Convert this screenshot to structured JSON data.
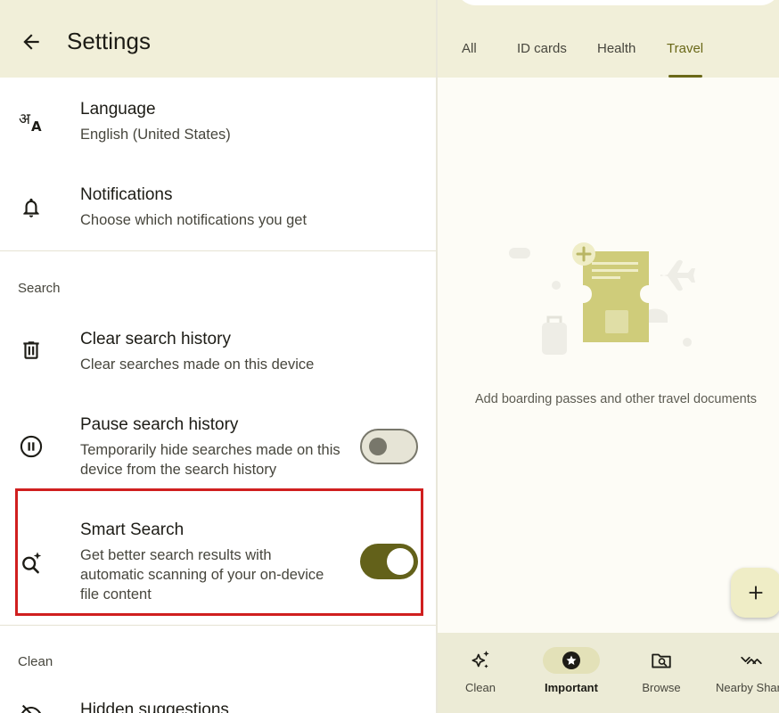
{
  "settings": {
    "title": "Settings",
    "general_items": [
      {
        "title": "Language",
        "subtitle": "English (United States)",
        "icon": "translate-icon"
      },
      {
        "title": "Notifications",
        "subtitle": "Choose which notifications you get",
        "icon": "bell-icon"
      }
    ],
    "search_section": {
      "label": "Search",
      "items": [
        {
          "title": "Clear search history",
          "subtitle": "Clear searches made on this device",
          "icon": "trash-icon"
        },
        {
          "title": "Pause search history",
          "subtitle": "Temporarily hide searches made on this device from the search history",
          "icon": "pause-circle-icon",
          "toggle": "off"
        },
        {
          "title": "Smart Search",
          "subtitle": "Get better search results with automatic scanning of your on-device file content",
          "icon": "smart-search-icon",
          "toggle": "on"
        }
      ]
    },
    "clean_section": {
      "label": "Clean",
      "items": [
        {
          "title": "Hidden suggestions",
          "icon": "hidden-icon"
        }
      ]
    }
  },
  "important": {
    "tabs": [
      {
        "label": "All",
        "active": false
      },
      {
        "label": "ID cards",
        "active": false
      },
      {
        "label": "Health",
        "active": false
      },
      {
        "label": "Travel",
        "active": true
      }
    ],
    "empty_state_text": "Add boarding passes and other travel documents",
    "fab_label": "+",
    "bottom_nav": [
      {
        "label": "Clean",
        "icon": "sparkle-icon",
        "active": false
      },
      {
        "label": "Important",
        "icon": "star-circle-icon",
        "active": true
      },
      {
        "label": "Browse",
        "icon": "folder-search-icon",
        "active": false
      },
      {
        "label": "Nearby Share",
        "icon": "nearby-share-icon",
        "active": false
      }
    ]
  },
  "colors": {
    "header_bg": "#f1efd9",
    "accent": "#63611a",
    "highlight_border": "#d01f1f",
    "nav_bg": "#ecebd6"
  }
}
